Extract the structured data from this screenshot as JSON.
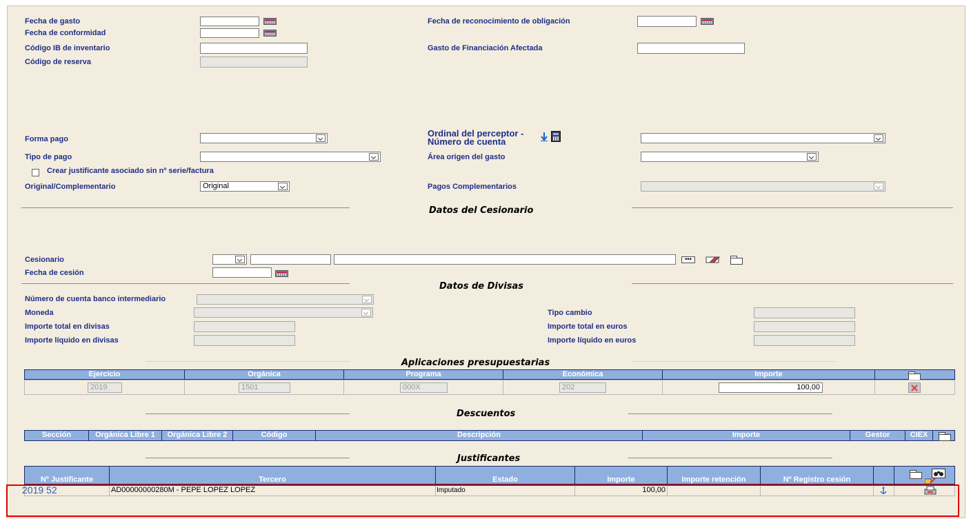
{
  "fields": {
    "fecha_gasto": "Fecha de gasto",
    "fecha_conformidad": "Fecha de conformidad",
    "codigo_ib": "Código IB de inventario",
    "codigo_reserva": "Código de reserva",
    "fecha_reconocimiento": "Fecha de reconocimiento de obligación",
    "gasto_financiacion": "Gasto de Financiación Afectada",
    "forma_pago": "Forma pago",
    "tipo_pago": "Tipo de pago",
    "crear_justificante": "Crear justificante asociado sin nº serie/factura",
    "original_complementario": "Original/Complementario",
    "original_complementario_value": "Original",
    "ordinal_line1": "Ordinal del perceptor -",
    "ordinal_line2": "Número de cuenta",
    "area_origen": "Área origen del gasto",
    "pagos_complementarios": "Pagos Complementarios"
  },
  "cesionario": {
    "title": "Datos del Cesionario",
    "label": "Cesionario",
    "fecha_cesion": "Fecha de cesión"
  },
  "divisas": {
    "title": "Datos de Divisas",
    "cuenta_banco": "Número de cuenta banco intermediario",
    "moneda": "Moneda",
    "total_divisas": "Importe total en divisas",
    "liquido_divisas": "Importe líquido en divisas",
    "tipo_cambio": "Tipo cambio",
    "total_euros": "Importe total en euros",
    "liquido_euros": "Importe líquido en euros"
  },
  "aplicaciones": {
    "title": "Aplicaciones presupuestarias",
    "headers": [
      "Ejercicio",
      "Orgánica",
      "Programa",
      "Económica",
      "Importe"
    ],
    "row": {
      "ejercicio": "2019",
      "organica": "1501",
      "programa": "000X",
      "economica": "202",
      "importe": "100,00"
    }
  },
  "descuentos": {
    "title": "Descuentos",
    "headers": [
      "Sección",
      "Orgánica Libre 1",
      "Orgánica Libre 2",
      "Código",
      "Descripción",
      "Importe",
      "Gestor",
      "CIEX"
    ]
  },
  "justificantes": {
    "title": "Justificantes",
    "headers": [
      "Nº Justificante",
      "Tercero",
      "Estado",
      "Importe",
      "Importe retención",
      "Nº Registro cesión"
    ],
    "row": {
      "numero": "2019 52",
      "tercero": "AD00000000280M - PEPE LOPEZ LOPEZ",
      "estado": "Imputado",
      "importe": "100,00"
    }
  },
  "colors": {
    "background": "#f3ede0",
    "label": "#1f2f85",
    "table_header": "#8fb0df",
    "link": "#2a5db0",
    "highlight_border": "#e00000"
  }
}
